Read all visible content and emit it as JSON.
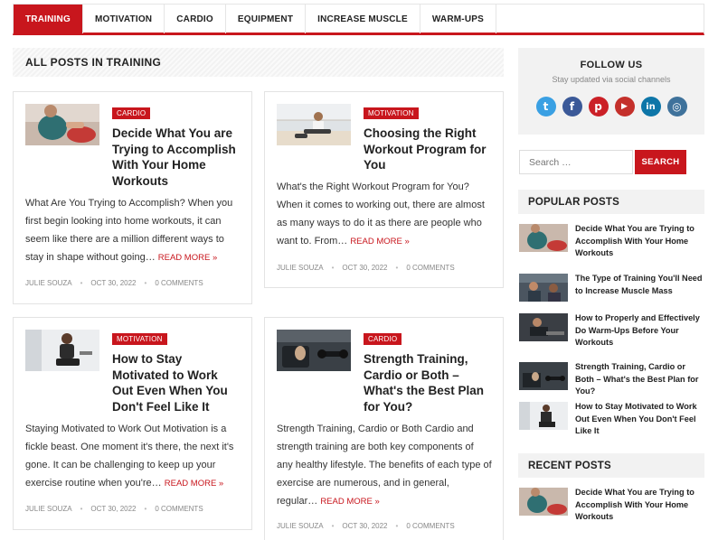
{
  "nav": {
    "items": [
      {
        "label": "TRAINING",
        "active": true
      },
      {
        "label": "MOTIVATION",
        "active": false
      },
      {
        "label": "CARDIO",
        "active": false
      },
      {
        "label": "EQUIPMENT",
        "active": false
      },
      {
        "label": "INCREASE MUSCLE",
        "active": false
      },
      {
        "label": "WARM-UPS",
        "active": false
      }
    ]
  },
  "archive_title": "ALL POSTS IN TRAINING",
  "posts": [
    {
      "category": "CARDIO",
      "title": "Decide What You are Trying to Accomplish With Your Home Workouts",
      "excerpt": "What Are You Trying to Accomplish? When you first begin looking into home workouts, it can seem like there are a million different ways to stay in shape without going…",
      "read_more": "READ MORE »",
      "author": "JULIE SOUZA",
      "date": "OCT 30, 2022",
      "comments": "0 COMMENTS"
    },
    {
      "category": "MOTIVATION",
      "title": "Choosing the Right Workout Program for You",
      "excerpt": "What's the Right Workout Program for You? When it comes to working out, there are almost as many ways to do it as there are people who want to. From…",
      "read_more": "READ MORE »",
      "author": "JULIE SOUZA",
      "date": "OCT 30, 2022",
      "comments": "0 COMMENTS"
    },
    {
      "category": "MOTIVATION",
      "title": "How to Stay Motivated to Work Out Even When You Don't Feel Like It",
      "excerpt": "Staying Motivated to Work Out Motivation is a fickle beast. One moment it's there, the next it's gone. It can be challenging to keep up your exercise routine when you're…",
      "read_more": "READ MORE »",
      "author": "JULIE SOUZA",
      "date": "OCT 30, 2022",
      "comments": "0 COMMENTS"
    },
    {
      "category": "CARDIO",
      "title": "Strength Training, Cardio or Both – What's the Best Plan for You?",
      "excerpt": "Strength Training, Cardio or Both Cardio and strength training are both key components of any healthy lifestyle. The benefits of each type of exercise are numerous, and in general, regular…",
      "read_more": "READ MORE »",
      "author": "JULIE SOUZA",
      "date": "OCT 30, 2022",
      "comments": "0 COMMENTS"
    }
  ],
  "sidebar": {
    "follow_title": "FOLLOW US",
    "follow_subtitle": "Stay updated via social channels",
    "socials": [
      {
        "icon": "twitter-icon",
        "glyph": "t",
        "color": "#3aa0e3"
      },
      {
        "icon": "facebook-icon",
        "glyph": "f",
        "color": "#3b5998"
      },
      {
        "icon": "pinterest-icon",
        "glyph": "p",
        "color": "#cb2027"
      },
      {
        "icon": "youtube-icon",
        "glyph": "▶",
        "color": "#c4302b"
      },
      {
        "icon": "linkedin-icon",
        "glyph": "in",
        "color": "#0e76a8"
      },
      {
        "icon": "instagram-icon",
        "glyph": "◎",
        "color": "#3f729b"
      }
    ],
    "search_placeholder": "Search …",
    "search_button": "SEARCH",
    "popular_title": "POPULAR POSTS",
    "popular": [
      "Decide What You are Trying to Accomplish With Your Home Workouts",
      "The Type of Training You'll Need to Increase Muscle Mass",
      "How to Properly and Effectively Do Warm-Ups Before Your Workouts",
      "Strength Training, Cardio or Both – What's the Best Plan for You?",
      "How to Stay Motivated to Work Out Even When You Don't Feel Like It"
    ],
    "recent_title": "RECENT POSTS",
    "recent": [
      "Decide What You are Trying to Accomplish With Your Home Workouts"
    ]
  },
  "colors": {
    "accent": "#c8161d",
    "widget_bg": "#f2f2f2"
  }
}
